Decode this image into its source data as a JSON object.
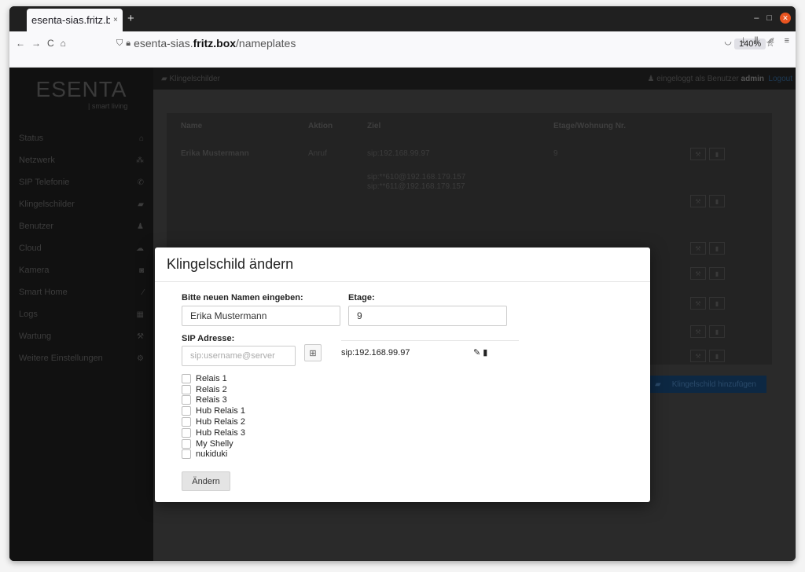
{
  "browser": {
    "tab_title": "esenta-sias.fritz.b",
    "tab_close": "×",
    "new_tab": "+",
    "url_prefix": "esenta-sias.",
    "url_domain": "fritz.box",
    "url_path": "/nameplates",
    "zoom": "140%",
    "nav_back": "←",
    "nav_forward": "→",
    "nav_reload": "C",
    "nav_home": "⌂",
    "min": "–",
    "max": "□",
    "close": "✕"
  },
  "app": {
    "logo": "ESENTA",
    "logo_sub": "| smart living",
    "breadcrumb": "Klingelschilder",
    "logged_in_prefix": "eingeloggt als Benutzer",
    "logged_in_user": "admin",
    "logout": "Logout",
    "sidebar": [
      {
        "label": "Status",
        "icon": "home-icon",
        "glyph": "⌂"
      },
      {
        "label": "Netzwerk",
        "icon": "network-icon",
        "glyph": "⁂"
      },
      {
        "label": "SIP Telefonie",
        "icon": "phone-icon",
        "glyph": "✆"
      },
      {
        "label": "Klingelschilder",
        "icon": "nameplate-icon",
        "glyph": "▰"
      },
      {
        "label": "Benutzer",
        "icon": "users-icon",
        "glyph": "♟"
      },
      {
        "label": "Cloud",
        "icon": "cloud-icon",
        "glyph": "☁"
      },
      {
        "label": "Kamera",
        "icon": "camera-icon",
        "glyph": "◙"
      },
      {
        "label": "Smart Home",
        "icon": "wand-icon",
        "glyph": "⁄"
      },
      {
        "label": "Logs",
        "icon": "calendar-icon",
        "glyph": "▦"
      },
      {
        "label": "Wartung",
        "icon": "wrench-icon",
        "glyph": "⚒"
      },
      {
        "label": "Weitere Einstellungen",
        "icon": "cogs-icon",
        "glyph": "⚙"
      }
    ],
    "table": {
      "headers": [
        "Name",
        "Aktion",
        "Ziel",
        "Etage/Wohnung Nr."
      ],
      "row1": {
        "name": "Erika Mustermann",
        "action": "Anruf",
        "target": "sip:192.168.99.97",
        "floor": "9"
      },
      "row2": {
        "target1": "sip:**610@192.168.179.157",
        "target2": "sip:**611@192.168.179.157"
      }
    },
    "add_button": "Klingelschild hinzufügen"
  },
  "modal": {
    "title": "Klingelschild ändern",
    "name_label": "Bitte neuen Namen eingeben:",
    "name_value": "Erika Mustermann",
    "floor_label": "Etage:",
    "floor_value": "9",
    "sip_label": "SIP Adresse:",
    "sip_placeholder": "sip:username@server",
    "sip_entry": "sip:192.168.99.97",
    "checkboxes": [
      "Relais 1",
      "Relais 2",
      "Relais 3",
      "Hub Relais 1",
      "Hub Relais 2",
      "Hub Relais 3",
      "My Shelly",
      "nukiduki"
    ],
    "submit": "Ändern"
  }
}
